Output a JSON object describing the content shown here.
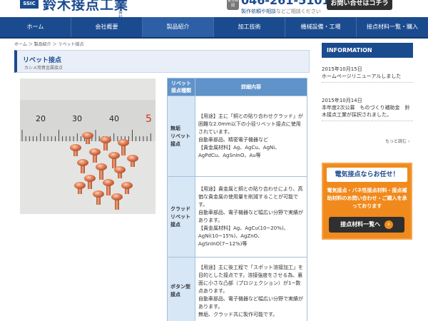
{
  "header": {
    "logo_text": "SSIC",
    "company_name": "鈴木接点工業",
    "company_suffix": "株式会社",
    "phone_badge": "受付時間",
    "phone_number": "046-261-5101",
    "phone_note_prefix": "",
    "phone_note_highlight": "製作依頼や相談",
    "phone_note_suffix": "などご相談ください",
    "contact_button": "お問い合せはコチラ"
  },
  "nav": {
    "items": [
      "ホーム",
      "会社概要",
      "製品紹介",
      "加工技術",
      "機械設備・工場",
      "接点材料一覧・購入"
    ],
    "active_index": 2
  },
  "breadcrumb": "ホーム ＞ 製品紹介 ＞ リベット接点",
  "page": {
    "title": "リベット接点",
    "subtitle": "カシメ用貴金属接点"
  },
  "spec_table": {
    "headers": [
      "リベット\n接点種類",
      "詳細内容"
    ],
    "rows": [
      {
        "type": "無垢\nリベット\n接点",
        "lines": [
          "【用途】主に「銅との貼り合わせクラッド」が困難な2.0mm以下の小径リベット接点に使用されています。",
          "自動車部品、精密電子機器など",
          "【貴金属材料】Ag、AgCu、AgNi、AgPdCu、AgSnInO、Au等"
        ]
      },
      {
        "type": "クラッド　リベット接点",
        "lines": [
          "【用途】貴金属と銅との貼り合わせにより、高価な貴金属の使用量を削減することが可能です。",
          "自動車部品、電子機器など幅広い分野で実績があります。",
          "【貴金属材料】Ag、AgCu(10~20%)、AgNi(10~15%)、AgZnO、AgSnInO(7~12%)等"
        ]
      },
      {
        "type": "ボタン型\n接点",
        "lines": [
          "【用途】主に後工程で「スポット溶接加工」を目的とした接点です。溶接強度をさせる為、裏面に小さな凸部（プロジェクション）が1~数点あります。",
          "自動車部品、電子機器など幅広い分野で実績があります。",
          "無垢、クラッド共に製作可能です。"
        ]
      }
    ]
  },
  "sidebar": {
    "info_header": "INFORMATION",
    "news": [
      {
        "date": "2015年10月15日",
        "text": "ホームページリニューアルしました"
      },
      {
        "date": "2015年10月14日",
        "text": "本年度2次公募　ものづくり補助金　鈴木接点工業が採択されました。"
      }
    ],
    "more_link": "もっと読む",
    "banner": {
      "title": "電気接点ならお任せ！",
      "text": "電気接点・バネ性接点材料・接点補助材料のお問い合わせ・ご購入を承っております",
      "button": "接点材料一覧へ"
    }
  },
  "colors": {
    "primary": "#1b4b8f",
    "accent": "#f08a1c",
    "table_header": "#5f93c9",
    "table_type_cell": "#d8e7f6"
  },
  "icons": {
    "more_link_icon": "chevron-right-icon",
    "banner_button_icon": "chevron-right-icon"
  },
  "photo": {
    "ruler_labels": [
      "20",
      "30",
      "40",
      "5"
    ]
  }
}
